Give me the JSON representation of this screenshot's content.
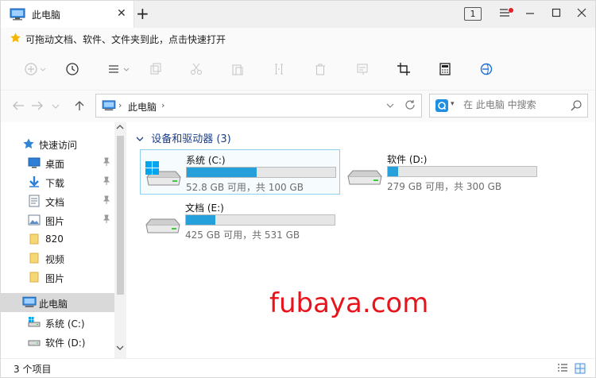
{
  "tab": {
    "title": "此电脑",
    "close_glyph": "✕",
    "new_glyph": "+"
  },
  "tab_count": "1",
  "favbar": {
    "hint": "可拖动文档、软件、文件夹到此，点击快速打开"
  },
  "address": {
    "crumb": "此电脑",
    "separator": "›"
  },
  "search": {
    "placeholder": "在 此电脑 中搜索"
  },
  "sidebar": {
    "items": [
      {
        "label": "快速访问",
        "icon": "star-icon",
        "pinned": false
      },
      {
        "label": "桌面",
        "icon": "desktop-icon",
        "pinned": true
      },
      {
        "label": "下载",
        "icon": "download-icon",
        "pinned": true
      },
      {
        "label": "文档",
        "icon": "document-icon",
        "pinned": true
      },
      {
        "label": "图片",
        "icon": "pictures-icon",
        "pinned": true
      },
      {
        "label": "820",
        "icon": "folder-icon",
        "pinned": false
      },
      {
        "label": "视频",
        "icon": "folder-icon",
        "pinned": false
      },
      {
        "label": "图片",
        "icon": "folder-icon",
        "pinned": false
      },
      {
        "label": "此电脑",
        "icon": "computer-icon",
        "pinned": false
      },
      {
        "label": "系统 (C:)",
        "icon": "drive-icon",
        "pinned": false
      },
      {
        "label": "软件 (D:)",
        "icon": "drive-icon",
        "pinned": false
      }
    ]
  },
  "group": {
    "title": "设备和驱动器 (3)"
  },
  "drives": [
    {
      "name": "系统 (C:)",
      "free_text": "52.8 GB 可用，共 100 GB",
      "used_fraction": 0.472,
      "system": true
    },
    {
      "name": "软件 (D:)",
      "free_text": "279 GB 可用，共 300 GB",
      "used_fraction": 0.07,
      "system": false
    },
    {
      "name": "文档 (E:)",
      "free_text": "425 GB 可用，共 531 GB",
      "used_fraction": 0.2,
      "system": false
    }
  ],
  "watermark": "fubaya.com",
  "status": {
    "count": "3 个项目"
  },
  "colors": {
    "accent": "#26a0da",
    "group_head": "#1a3e8c",
    "watermark": "#e8141c",
    "selected": "#d9d9d9"
  }
}
